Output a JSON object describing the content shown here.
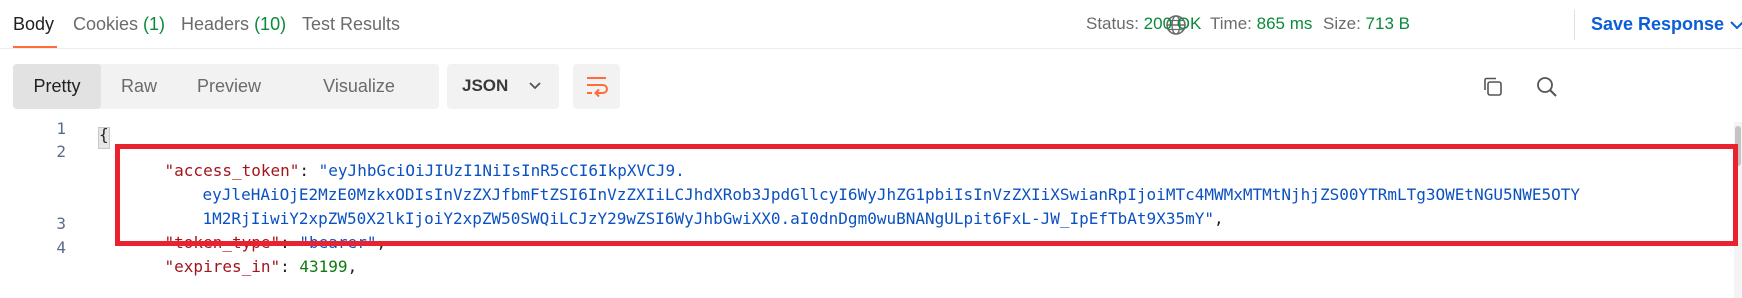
{
  "tabs": [
    {
      "label": "Body",
      "count": ""
    },
    {
      "label": "Cookies",
      "count": "(1)"
    },
    {
      "label": "Headers",
      "count": "(10)"
    },
    {
      "label": "Test Results",
      "count": ""
    }
  ],
  "status": {
    "status_label": "Status:",
    "status_value": "200 OK",
    "time_label": "Time:",
    "time_value": "865 ms",
    "size_label": "Size:",
    "size_value": "713 B"
  },
  "save_response_label": "Save Response",
  "view_modes": [
    "Pretty",
    "Raw",
    "Preview",
    "Visualize"
  ],
  "format": "JSON",
  "code": {
    "line_numbers": [
      "1",
      "2",
      "3",
      "4"
    ],
    "open_brace": "{",
    "access_token_key": "\"access_token\"",
    "access_token_line1": "\"eyJhbGciOiJIUzI1NiIsInR5cCI6IkpXVCJ9.",
    "access_token_line2": "eyJleHAiOjE2MzE0MzkxODIsInVzZXJfbmFtZSI6InVzZXIiLCJhdXRob3JpdGllcyI6WyJhZG1pbiIsInVzZXIiXSwianRpIjoiMTc4MWMxMTMtNjhjZS00YTRmLTg3OWEtNGU5NWE5OTY",
    "access_token_line3": "1M2RjIiwiY2xpZW50X2lkIjoiY2xpZW50SWQiLCJzY29wZSI6WyJhbGwiXX0.aI0dnDgm0wuBNANgULpit6FxL-JW_IpEfTbAt9X35mY\"",
    "token_type_key": "\"token_type\"",
    "token_type_value": "\"bearer\"",
    "expires_in_key": "\"expires_in\"",
    "expires_in_value": "43199",
    "colon": ": ",
    "comma": ","
  },
  "colors": {
    "accent": "#ff6c37",
    "success": "#0a8a3a",
    "link": "#0b5ed7",
    "highlight": "#e8232f",
    "json_key": "#a3151d",
    "json_string": "#0b51c1"
  },
  "icons": [
    "globe-icon",
    "chevron-down-icon",
    "wrap-lines-icon",
    "copy-icon",
    "search-icon"
  ]
}
